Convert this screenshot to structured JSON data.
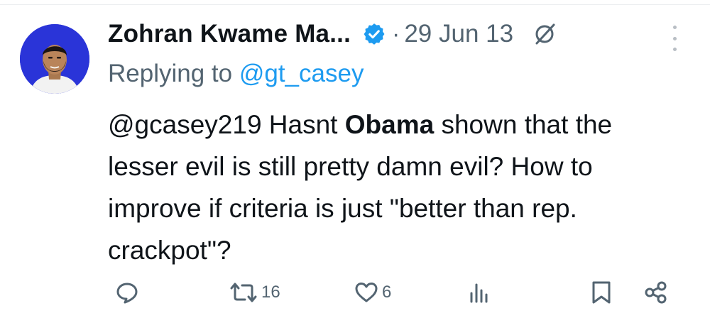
{
  "tweet": {
    "author_name": "Zohran Kwame Ma...",
    "separator": "·",
    "date": "29 Jun 13",
    "replying_prefix": "Replying to ",
    "replying_handle": "@gt_casey",
    "text_part1": "@gcasey219 Hasnt ",
    "text_bold": "Obama",
    "text_part2": " shown that the lesser evil is still pretty damn evil? How to improve if criteria is just \"better than rep. crackpot\"?"
  },
  "actions": {
    "reply_icon": "speech-bubble-icon",
    "retweet_icon": "retweet-icon",
    "retweet_count": "16",
    "like_icon": "heart-icon",
    "like_count": "6",
    "views_icon": "bar-chart-icon",
    "bookmark_icon": "bookmark-icon",
    "share_icon": "share-icon"
  },
  "colors": {
    "text": "#0f1419",
    "muted": "#536471",
    "link": "#1d9bf0",
    "verified": "#1d9bf0",
    "avatar_bg": "#2a34d8"
  }
}
